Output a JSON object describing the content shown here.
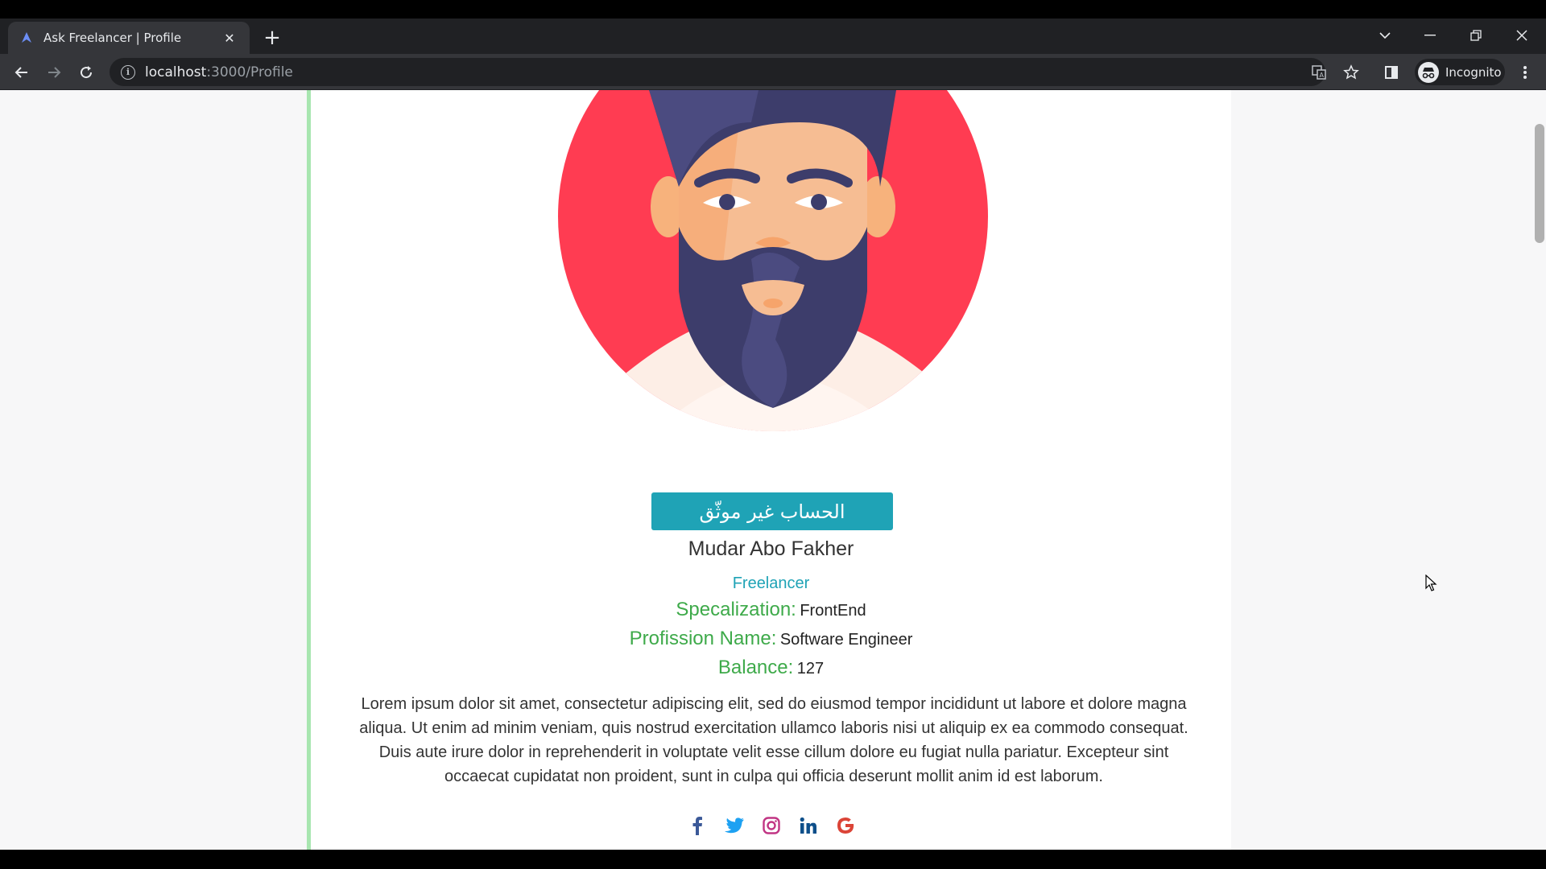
{
  "browser": {
    "tab_title": "Ask Freelancer | Profile",
    "url_host": "localhost",
    "url_path": ":3000/Profile",
    "incognito_label": "Incognito"
  },
  "profile": {
    "verify_button": "الحساب غير موثّق",
    "name": "Mudar Abo Fakher",
    "role": "Freelancer",
    "fields": [
      {
        "key": "Specalization:",
        "value": "FrontEnd"
      },
      {
        "key": "Profission Name:",
        "value": "Software Engineer"
      },
      {
        "key": "Balance:",
        "value": "127"
      }
    ],
    "bio": "Lorem ipsum dolor sit amet, consectetur adipiscing elit, sed do eiusmod tempor incididunt ut labore et dolore magna aliqua. Ut enim ad minim veniam, quis nostrud exercitation ullamco laboris nisi ut aliquip ex ea commodo consequat. Duis aute irure dolor in reprehenderit in voluptate velit esse cillum dolore eu fugiat nulla pariatur. Excepteur sint occaecat cupidatat non proident, sunt in culpa qui officia deserunt mollit anim id est laborum.",
    "socials": [
      {
        "name": "facebook-icon",
        "color": "#3b5998"
      },
      {
        "name": "twitter-icon",
        "color": "#1da1f2"
      },
      {
        "name": "instagram-icon",
        "color": "#c13584"
      },
      {
        "name": "linkedin-icon",
        "color": "#0e4f8a"
      },
      {
        "name": "google-icon",
        "color": "#db4437"
      }
    ]
  },
  "colors": {
    "accent": "#1fa3b6",
    "label_green": "#3eaa4a",
    "avatar_bg": "#ff3c52"
  }
}
